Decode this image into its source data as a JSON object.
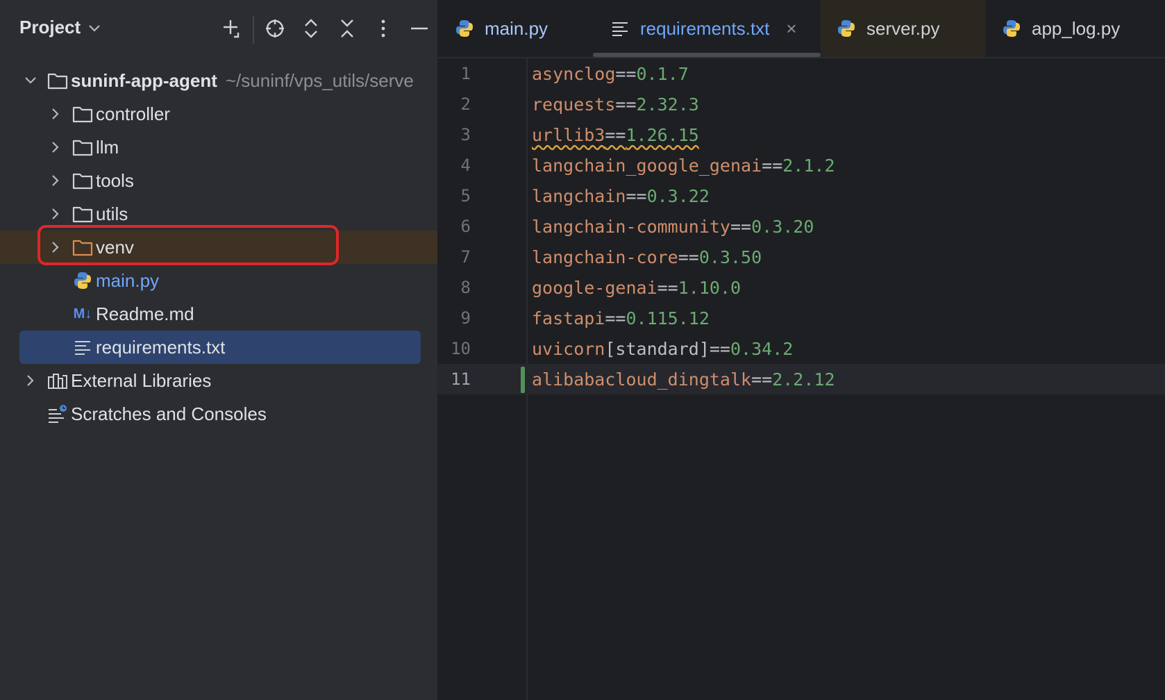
{
  "project_panel": {
    "title": "Project",
    "root": {
      "name": "suninf-app-agent",
      "path": "~/suninf/vps_utils/serve"
    },
    "items": [
      {
        "label": "controller",
        "type": "folder"
      },
      {
        "label": "llm",
        "type": "folder"
      },
      {
        "label": "tools",
        "type": "folder"
      },
      {
        "label": "utils",
        "type": "folder"
      },
      {
        "label": "venv",
        "type": "folder-excluded"
      },
      {
        "label": "main.py",
        "type": "python"
      },
      {
        "label": "Readme.md",
        "type": "markdown"
      },
      {
        "label": "requirements.txt",
        "type": "text",
        "selected": true
      }
    ],
    "external_libraries": "External Libraries",
    "scratches": "Scratches and Consoles",
    "markdown_badge": "M↓"
  },
  "tabs": [
    {
      "label": "main.py",
      "icon": "python-icon"
    },
    {
      "label": "requirements.txt",
      "icon": "text-file-icon",
      "active": true
    },
    {
      "label": "server.py",
      "icon": "python-icon"
    },
    {
      "label": "app_log.py",
      "icon": "python-icon"
    }
  ],
  "close_glyph": "×",
  "editor": {
    "current_line": 11,
    "lines": [
      {
        "n": "1",
        "pkg": "asynclog",
        "op": "==",
        "ver": "0.1.7"
      },
      {
        "n": "2",
        "pkg": "requests",
        "op": "==",
        "ver": "2.32.3"
      },
      {
        "n": "3",
        "pkg": "urllib3",
        "op": "==",
        "ver": "1.26.15"
      },
      {
        "n": "4",
        "pkg": "langchain_google_genai",
        "op": "==",
        "ver": "2.1.2"
      },
      {
        "n": "5",
        "pkg": "langchain",
        "op": "==",
        "ver": "0.3.22"
      },
      {
        "n": "6",
        "pkg": "langchain-community",
        "op": "==",
        "ver": "0.3.20"
      },
      {
        "n": "7",
        "pkg": "langchain-core",
        "op": "==",
        "ver": "0.3.50"
      },
      {
        "n": "8",
        "pkg": "google-genai",
        "op": "==",
        "ver": "1.10.0"
      },
      {
        "n": "9",
        "pkg": "fastapi",
        "op": "==",
        "ver": "0.115.12"
      },
      {
        "n": "10",
        "pkg": "uvicorn",
        "extra": "[standard]",
        "op": "==",
        "ver": "0.34.2"
      },
      {
        "n": "11",
        "pkg": "alibabacloud_dingtalk",
        "op": "==",
        "ver": "2.2.12"
      }
    ]
  },
  "colors": {
    "panel_bg": "#2b2d30",
    "editor_bg": "#1e1f22",
    "selection": "#2e436e",
    "highlight_box": "#e0262a",
    "package": "#cf8e6d",
    "version": "#6aab73"
  }
}
